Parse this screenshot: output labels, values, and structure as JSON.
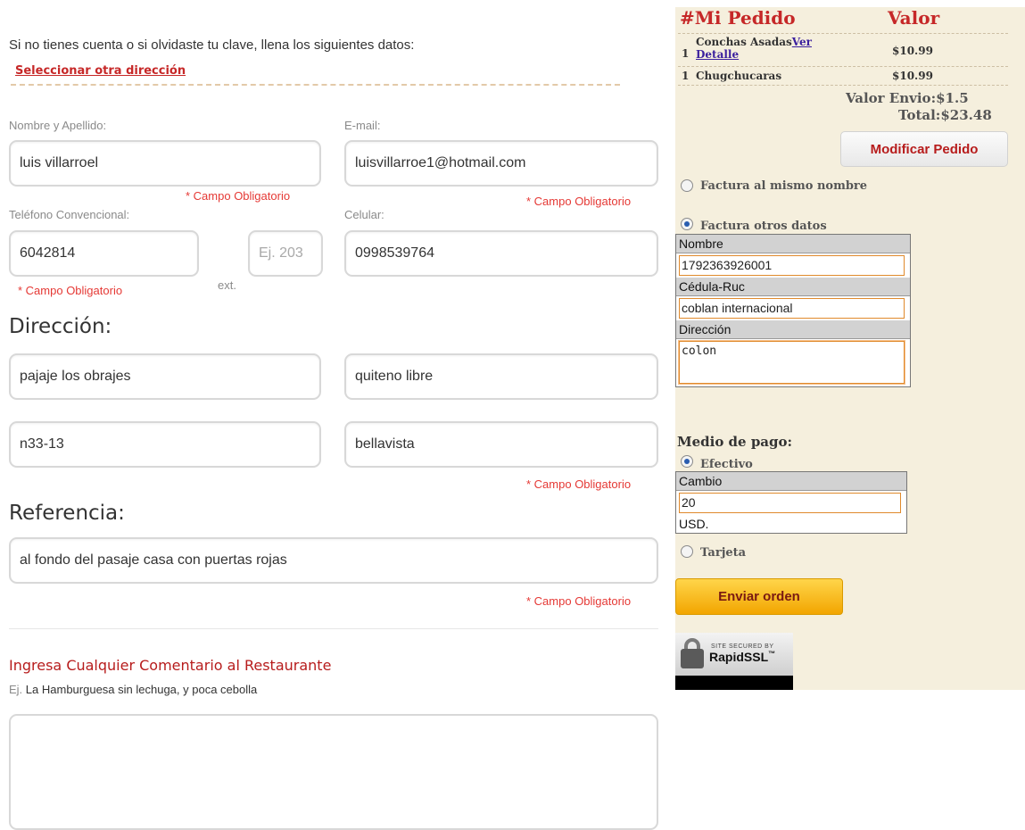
{
  "form": {
    "intro": "Si no tienes cuenta o si olvidaste tu clave, llena los siguientes datos:",
    "select_address_link": "Seleccionar otra dirección",
    "name_label": "Nombre y Apellido:",
    "name_value": "luis villarroel",
    "email_label": "E-mail:",
    "email_value": "luisvillarroe1@hotmail.com",
    "required_text": "* Campo Obligatorio",
    "phone_label": "Teléfono Convencional:",
    "phone_value": "6042814",
    "ext_label": "ext.",
    "ext_placeholder": "Ej. 203",
    "cell_label": "Celular:",
    "cell_value": "0998539764",
    "address_heading": "Dirección:",
    "street1_value": "pajaje los obrajes",
    "street2_value": "quiteno libre",
    "number_value": "n33-13",
    "sector_value": "bellavista",
    "reference_heading": "Referencia:",
    "reference_value": "al fondo del pasaje casa con puertas rojas",
    "comment_title": "Ingresa Cualquier Comentario al Restaurante",
    "comment_example_prefix": "Ej.",
    "comment_example": "La Hamburguesa sin lechuga, y poca cebolla",
    "comment_value": ""
  },
  "order": {
    "header_hash": "#",
    "header_title": "Mi Pedido",
    "header_value": "Valor",
    "items": [
      {
        "qty": "1",
        "name": "Conchas Asadas",
        "link": "Ver Detalle",
        "price": "$10.99"
      },
      {
        "qty": "1",
        "name": "Chugchucaras",
        "link": "",
        "price": "$10.99"
      }
    ],
    "shipping_label": "Valor Envio:",
    "shipping_value": "$1.5",
    "total_label": "Total:",
    "total_value": "$23.48",
    "modify_button": "Modificar Pedido"
  },
  "invoice": {
    "same_name_label": "Factura al mismo nombre",
    "other_data_label": "Factura otros datos",
    "selected": "other",
    "name_header": "Nombre",
    "name_value": "1792363926001",
    "ruc_header": "Cédula-Ruc",
    "ruc_value": "coblan internacional",
    "address_header": "Dirección",
    "address_value": "colon"
  },
  "payment": {
    "title": "Medio de pago:",
    "cash_label": "Efectivo",
    "change_header": "Cambio",
    "change_value": "20",
    "currency": "USD.",
    "card_label": "Tarjeta",
    "selected": "cash",
    "send_button": "Enviar orden"
  },
  "badge": {
    "small_text": "SITE SECURED BY",
    "brand": "RapidSSL",
    "tm": "™"
  },
  "colors": {
    "accent_red": "#c62828",
    "sidebar_bg": "#f5efdd",
    "send_button": "#f7b500"
  }
}
